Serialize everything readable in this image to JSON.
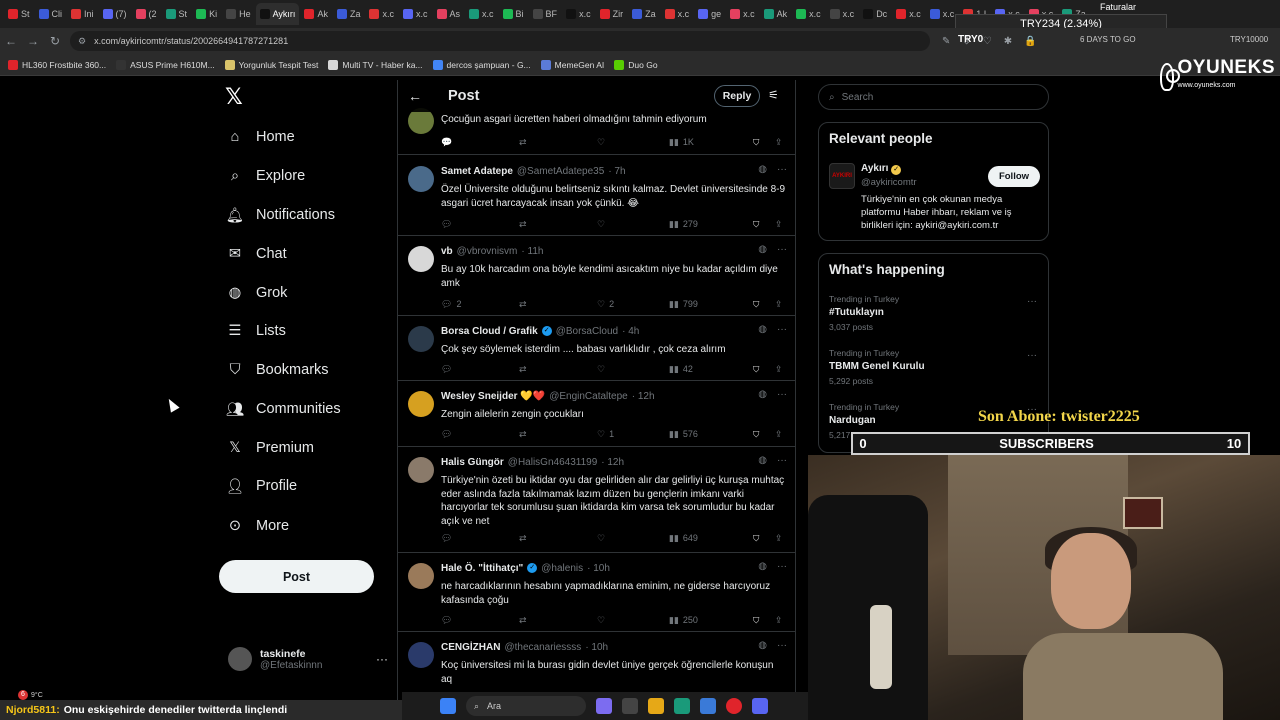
{
  "browser": {
    "tabs": [
      "St",
      "Cli",
      "Ini",
      "(7)",
      "(2",
      "St",
      "Ki",
      "He",
      "Aykırı",
      "Ak",
      "Za",
      "x.c",
      "x.c",
      "As",
      "x.c",
      "Bi",
      "BF",
      "x.c",
      "Zir",
      "Za",
      "x.c",
      "ge",
      "x.c",
      "Ak",
      "x.c",
      "x.c",
      "Dc",
      "x.c",
      "x.c",
      "1 I",
      "x.c",
      "x.c",
      "Za"
    ],
    "url": "x.com/aykiricomtr/status/2002664941787271281",
    "bookmarks": [
      "HL360 Frostbite 360...",
      "ASUS Prime H610M...",
      "Yorgunluk Tespit Test",
      "Multi TV - Haber ka...",
      "dercos şampuan - G...",
      "MemeGen AI",
      "Duo Go"
    ]
  },
  "overlay": {
    "ticker": "TRY234 (2.34%)",
    "ticker_sub": "TRY0",
    "faturalar": "Faturalar",
    "days": "6 DAYS TO GO",
    "try_right": "TRY10000",
    "brand": "OYUNEKS",
    "brand_url": "www.oyuneks.com",
    "son_abone": "Son Abone: twister2225",
    "subs_label": "SUBSCRIBERS",
    "subs_current": "0",
    "subs_goal": "10",
    "chat_user": "Njord5811:",
    "chat_msg": "Onu eskişehirde denediler twitterda linçlendi",
    "weather_badge": "6",
    "weather_temp": "9°C",
    "taskbar_search": "Ara"
  },
  "nav": {
    "items": [
      {
        "label": "Home",
        "icon": "home-icon"
      },
      {
        "label": "Explore",
        "icon": "search-icon"
      },
      {
        "label": "Notifications",
        "icon": "bell-icon"
      },
      {
        "label": "Chat",
        "icon": "mail-icon"
      },
      {
        "label": "Grok",
        "icon": "grok-icon"
      },
      {
        "label": "Lists",
        "icon": "list-icon"
      },
      {
        "label": "Bookmarks",
        "icon": "bookmark-icon"
      },
      {
        "label": "Communities",
        "icon": "people-icon"
      },
      {
        "label": "Premium",
        "icon": "x-icon"
      },
      {
        "label": "Profile",
        "icon": "person-icon"
      },
      {
        "label": "More",
        "icon": "more-icon"
      }
    ],
    "post_label": "Post",
    "user_name": "taskinefe",
    "user_handle": "@Efetaskinnn"
  },
  "post": {
    "title": "Post",
    "reply_label": "Reply",
    "partial_text": "Çocuğun asgari ücretten haberi olmadığını tahmin ediyorum",
    "partial_views": "1K",
    "tweets": [
      {
        "name": "Samet Adatepe",
        "handle": "@SametAdatepe35",
        "time": "· 7h",
        "text": "Özel Üniversite olduğunu belirtseniz sıkıntı kalmaz. Devlet üniversitesinde 8-9 asgari ücret harcayacak insan yok çünkü. 😂",
        "replies": "",
        "likes": "",
        "views": "279",
        "avatar_color": "#4a6a8a"
      },
      {
        "name": "vb",
        "handle": "@vbrovnisvm",
        "time": "· 11h",
        "text": "Bu ay 10k harcadım ona böyle kendimi asıcaktım niye bu kadar açıldım diye amk",
        "replies": "2",
        "likes": "2",
        "views": "799",
        "avatar_color": "#d8d8d8"
      },
      {
        "name": "Borsa Cloud / Grafik",
        "handle": "@BorsaCloud",
        "time": "· 4h",
        "text": "Çok şey söylemek isterdim .... babası varlıklıdır , çok ceza alırım",
        "replies": "",
        "likes": "",
        "views": "42",
        "avatar_color": "#2b3a4a"
      },
      {
        "name": "Wesley Sneijder 💛❤️",
        "handle": "@EnginCataltepe",
        "time": "· 12h",
        "text": "Zengin ailelerin zengin çocukları",
        "replies": "",
        "likes": "1",
        "views": "576",
        "avatar_color": "#d6a020"
      },
      {
        "name": "Halis Güngör",
        "handle": "@HalisGn46431199",
        "time": "· 12h",
        "text": "Türkiye'nin özeti bu iktidar oyu dar gelirliden alır dar gelirliyi üç kuruşa muhtaç eder aslında fazla takılmamak lazım düzen bu gençlerin imkanı varki harcıyorlar tek sorumlusu şuan iktidarda kim varsa tek sorumludur bu kadar açık ve net",
        "replies": "",
        "likes": "",
        "views": "649",
        "avatar_color": "#8a7a6a"
      },
      {
        "name": "Hale Ö. \"İttihatçı\"",
        "handle": "@halenis",
        "time": "· 10h",
        "text": "ne harcadıklarının hesabını yapmadıklarına eminim, ne giderse harcıyoruz kafasında çoğu",
        "replies": "",
        "likes": "",
        "views": "250",
        "avatar_color": "#9a7a5a"
      },
      {
        "name": "CENGİZHAN",
        "handle": "@thecanariessss",
        "time": "· 10h",
        "text": "Koç üniversitesi mi la burası gidin devlet üniye gerçek öğrencilerle konuşun aq",
        "replies": "",
        "likes": "",
        "views": "",
        "avatar_color": "#2a3a6a"
      }
    ]
  },
  "right": {
    "search_placeholder": "Search",
    "relevant_title": "Relevant people",
    "person_name": "Aykırı",
    "person_handle": "@aykiricomtr",
    "person_bio": "Türkiye'nin en çok okunan medya platformu Haber ihbarı, reklam ve iş birlikleri için: aykiri@aykiri.com.tr",
    "follow_label": "Follow",
    "logo_text": "AYKIRI",
    "happening_title": "What's happening",
    "trends": [
      {
        "category": "Trending in Turkey",
        "name": "#Tutuklayın",
        "count": "3,037 posts"
      },
      {
        "category": "Trending in Turkey",
        "name": "TBMM Genel Kurulu",
        "count": "5,292 posts"
      },
      {
        "category": "Trending in Turkey",
        "name": "Nardugan",
        "count": "5,217 posts"
      }
    ]
  },
  "colors": {
    "accent": "#1d9bf0",
    "verified": "#1d9bf0",
    "gold": "#f2d54a",
    "muted": "#71767b"
  }
}
